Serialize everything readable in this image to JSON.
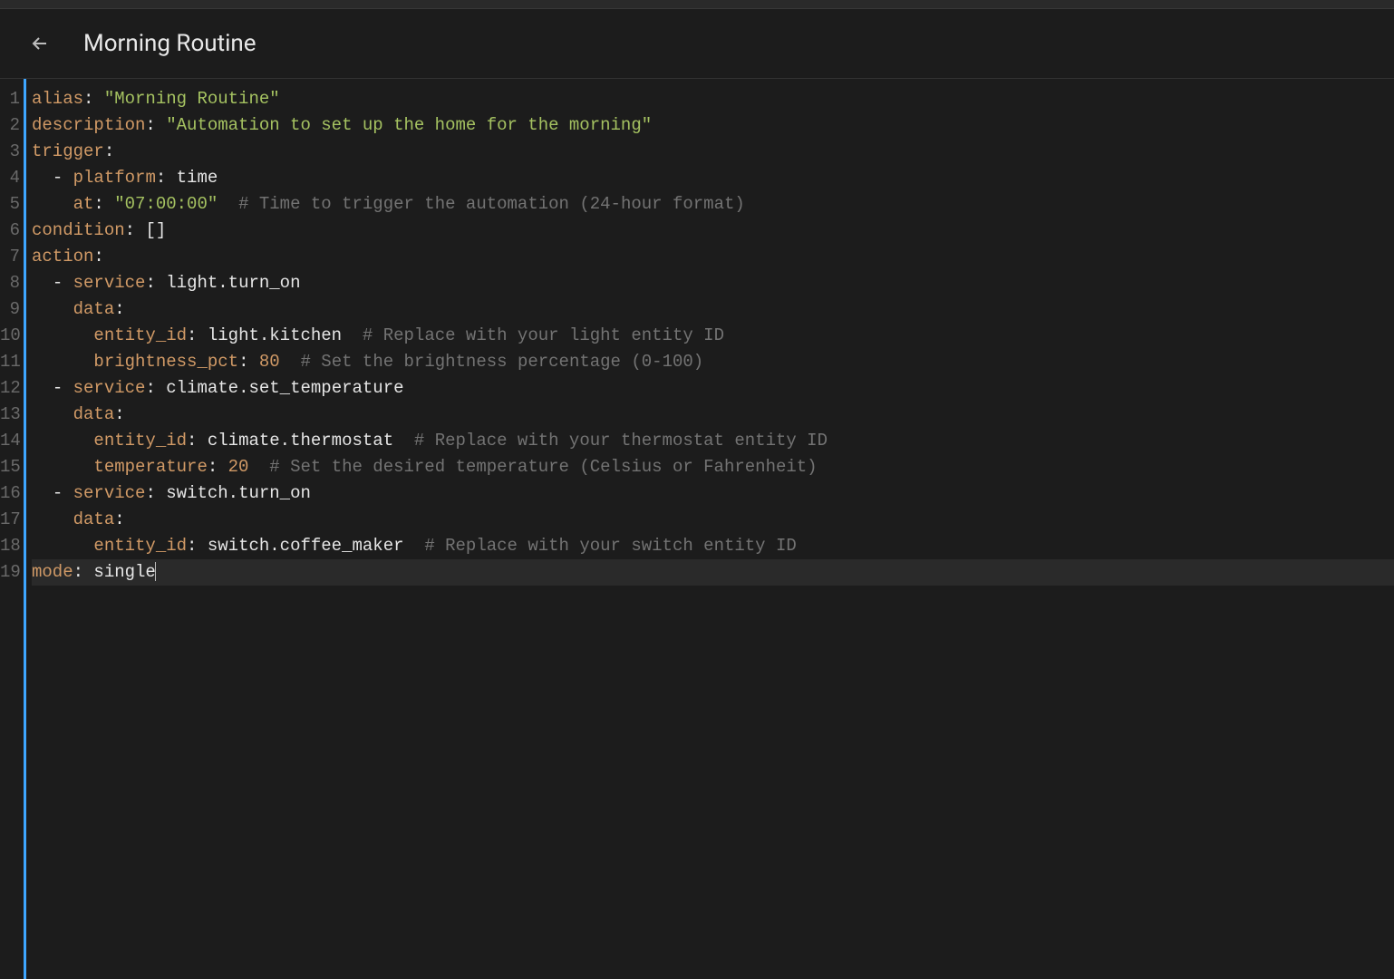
{
  "header": {
    "title": "Morning Routine"
  },
  "editor": {
    "line_numbers": [
      "1",
      "2",
      "3",
      "4",
      "5",
      "6",
      "7",
      "8",
      "9",
      "10",
      "11",
      "12",
      "13",
      "14",
      "15",
      "16",
      "17",
      "18",
      "19"
    ],
    "current_line": 19,
    "lines": [
      [
        {
          "cls": "tk-key",
          "t": "alias"
        },
        {
          "cls": "tk-punc",
          "t": ": "
        },
        {
          "cls": "tk-str",
          "t": "\"Morning Routine\""
        }
      ],
      [
        {
          "cls": "tk-key",
          "t": "description"
        },
        {
          "cls": "tk-punc",
          "t": ": "
        },
        {
          "cls": "tk-str",
          "t": "\"Automation to set up the home for the morning\""
        }
      ],
      [
        {
          "cls": "tk-key",
          "t": "trigger"
        },
        {
          "cls": "tk-punc",
          "t": ":"
        }
      ],
      [
        {
          "cls": "",
          "t": "  "
        },
        {
          "cls": "tk-dash",
          "t": "- "
        },
        {
          "cls": "tk-key",
          "t": "platform"
        },
        {
          "cls": "tk-punc",
          "t": ": "
        },
        {
          "cls": "tk-val",
          "t": "time"
        }
      ],
      [
        {
          "cls": "",
          "t": "    "
        },
        {
          "cls": "tk-key",
          "t": "at"
        },
        {
          "cls": "tk-punc",
          "t": ": "
        },
        {
          "cls": "tk-str",
          "t": "\"07:00:00\""
        },
        {
          "cls": "",
          "t": "  "
        },
        {
          "cls": "tk-cmt",
          "t": "# Time to trigger the automation (24-hour format)"
        }
      ],
      [
        {
          "cls": "tk-key",
          "t": "condition"
        },
        {
          "cls": "tk-punc",
          "t": ": "
        },
        {
          "cls": "tk-val",
          "t": "[]"
        }
      ],
      [
        {
          "cls": "tk-key",
          "t": "action"
        },
        {
          "cls": "tk-punc",
          "t": ":"
        }
      ],
      [
        {
          "cls": "",
          "t": "  "
        },
        {
          "cls": "tk-dash",
          "t": "- "
        },
        {
          "cls": "tk-key",
          "t": "service"
        },
        {
          "cls": "tk-punc",
          "t": ": "
        },
        {
          "cls": "tk-val",
          "t": "light.turn_on"
        }
      ],
      [
        {
          "cls": "",
          "t": "    "
        },
        {
          "cls": "tk-key",
          "t": "data"
        },
        {
          "cls": "tk-punc",
          "t": ":"
        }
      ],
      [
        {
          "cls": "",
          "t": "      "
        },
        {
          "cls": "tk-key",
          "t": "entity_id"
        },
        {
          "cls": "tk-punc",
          "t": ": "
        },
        {
          "cls": "tk-val",
          "t": "light.kitchen"
        },
        {
          "cls": "",
          "t": "  "
        },
        {
          "cls": "tk-cmt",
          "t": "# Replace with your light entity ID"
        }
      ],
      [
        {
          "cls": "",
          "t": "      "
        },
        {
          "cls": "tk-key",
          "t": "brightness_pct"
        },
        {
          "cls": "tk-punc",
          "t": ": "
        },
        {
          "cls": "tk-num",
          "t": "80"
        },
        {
          "cls": "",
          "t": "  "
        },
        {
          "cls": "tk-cmt",
          "t": "# Set the brightness percentage (0-100)"
        }
      ],
      [
        {
          "cls": "",
          "t": "  "
        },
        {
          "cls": "tk-dash",
          "t": "- "
        },
        {
          "cls": "tk-key",
          "t": "service"
        },
        {
          "cls": "tk-punc",
          "t": ": "
        },
        {
          "cls": "tk-val",
          "t": "climate.set_temperature"
        }
      ],
      [
        {
          "cls": "",
          "t": "    "
        },
        {
          "cls": "tk-key",
          "t": "data"
        },
        {
          "cls": "tk-punc",
          "t": ":"
        }
      ],
      [
        {
          "cls": "",
          "t": "      "
        },
        {
          "cls": "tk-key",
          "t": "entity_id"
        },
        {
          "cls": "tk-punc",
          "t": ": "
        },
        {
          "cls": "tk-val",
          "t": "climate.thermostat"
        },
        {
          "cls": "",
          "t": "  "
        },
        {
          "cls": "tk-cmt",
          "t": "# Replace with your thermostat entity ID"
        }
      ],
      [
        {
          "cls": "",
          "t": "      "
        },
        {
          "cls": "tk-key",
          "t": "temperature"
        },
        {
          "cls": "tk-punc",
          "t": ": "
        },
        {
          "cls": "tk-num",
          "t": "20"
        },
        {
          "cls": "",
          "t": "  "
        },
        {
          "cls": "tk-cmt",
          "t": "# Set the desired temperature (Celsius or Fahrenheit)"
        }
      ],
      [
        {
          "cls": "",
          "t": "  "
        },
        {
          "cls": "tk-dash",
          "t": "- "
        },
        {
          "cls": "tk-key",
          "t": "service"
        },
        {
          "cls": "tk-punc",
          "t": ": "
        },
        {
          "cls": "tk-val",
          "t": "switch.turn_on"
        }
      ],
      [
        {
          "cls": "",
          "t": "    "
        },
        {
          "cls": "tk-key",
          "t": "data"
        },
        {
          "cls": "tk-punc",
          "t": ":"
        }
      ],
      [
        {
          "cls": "",
          "t": "      "
        },
        {
          "cls": "tk-key",
          "t": "entity_id"
        },
        {
          "cls": "tk-punc",
          "t": ": "
        },
        {
          "cls": "tk-val",
          "t": "switch.coffee_maker"
        },
        {
          "cls": "",
          "t": "  "
        },
        {
          "cls": "tk-cmt",
          "t": "# Replace with your switch entity ID"
        }
      ],
      [
        {
          "cls": "tk-key",
          "t": "mode"
        },
        {
          "cls": "tk-punc",
          "t": ": "
        },
        {
          "cls": "tk-val",
          "t": "single"
        }
      ]
    ]
  }
}
